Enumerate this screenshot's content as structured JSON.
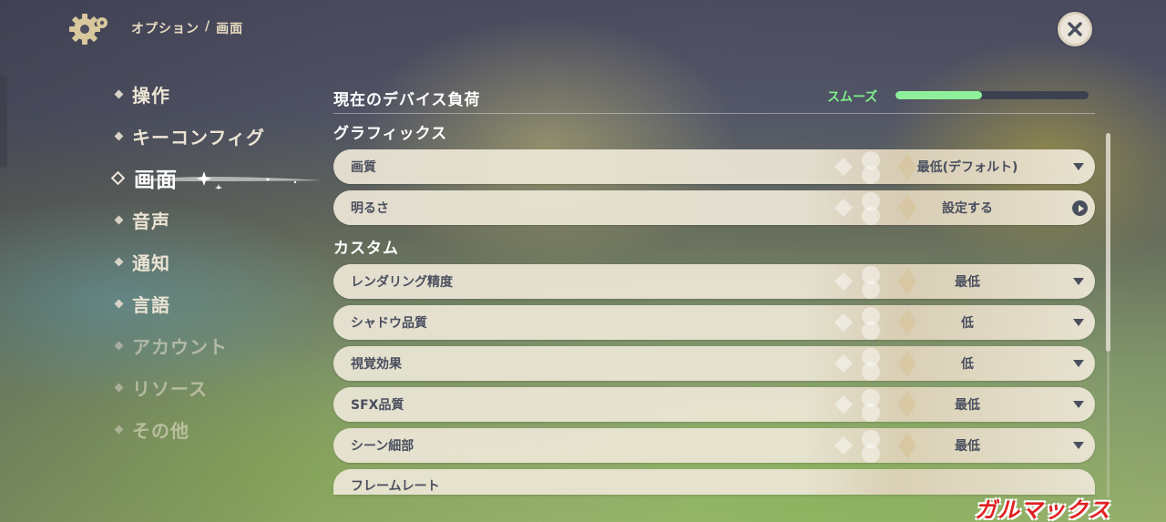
{
  "header": {
    "breadcrumb_parent": "オプション",
    "breadcrumb_separator": "/",
    "breadcrumb_current": "画面",
    "settings_icon": "gear-icon",
    "close_icon": "close-icon"
  },
  "sidebar": {
    "items": [
      {
        "label": "操作"
      },
      {
        "label": "キーコンフィグ"
      },
      {
        "label": "画面",
        "active": true
      },
      {
        "label": "音声"
      },
      {
        "label": "通知"
      },
      {
        "label": "言語"
      },
      {
        "label": "アカウント"
      },
      {
        "label": "リソース"
      },
      {
        "label": "その他"
      }
    ]
  },
  "device": {
    "title": "現在のデバイス負荷",
    "status_label": "スムーズ",
    "status_color": "#7ff08a",
    "load_fraction": 0.45
  },
  "graphics": {
    "title": "グラフィックス",
    "rows": [
      {
        "label": "画質",
        "value": "最低(デフォルト)",
        "control": "dropdown"
      },
      {
        "label": "明るさ",
        "value": "設定する",
        "control": "action"
      }
    ]
  },
  "custom": {
    "title": "カスタム",
    "rows": [
      {
        "label": "レンダリング精度",
        "value": "最低",
        "control": "dropdown"
      },
      {
        "label": "シャドウ品質",
        "value": "低",
        "control": "dropdown"
      },
      {
        "label": "視覚効果",
        "value": "低",
        "control": "dropdown"
      },
      {
        "label": "SFX品質",
        "value": "最低",
        "control": "dropdown"
      },
      {
        "label": "シーン細部",
        "value": "最低",
        "control": "dropdown"
      },
      {
        "label": "フレームレート"
      }
    ]
  },
  "watermark": {
    "text": "ガルマックス"
  }
}
